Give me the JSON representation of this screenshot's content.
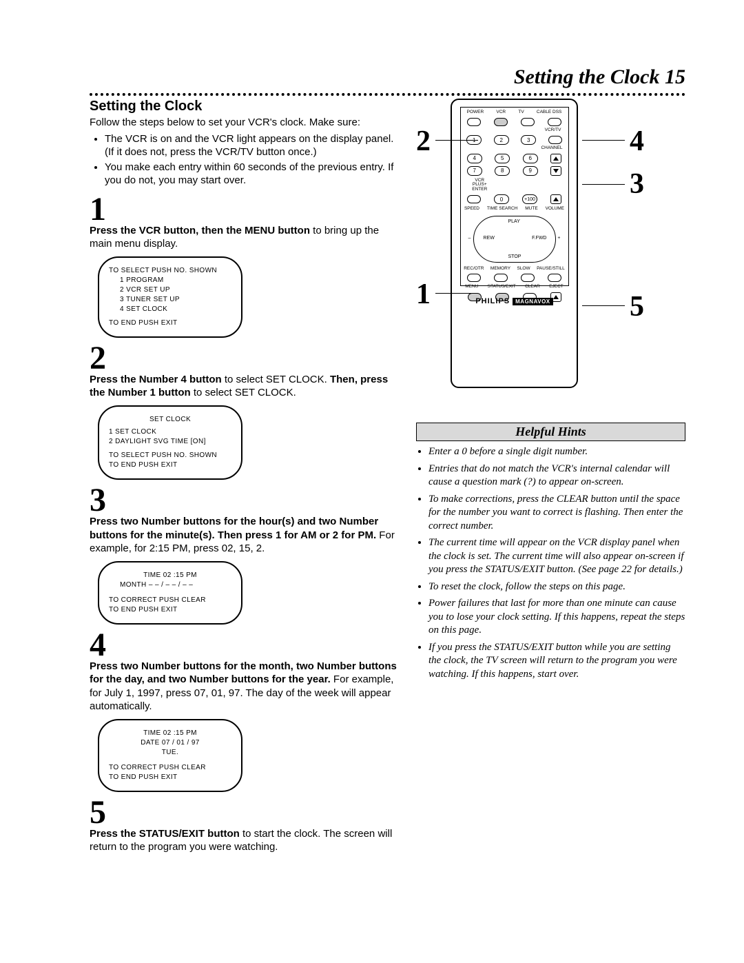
{
  "header": {
    "title": "Setting the Clock 15"
  },
  "section_title": "Setting the Clock",
  "intro": "Follow the steps below to set your VCR's clock. Make sure:",
  "bullets": [
    "The VCR is on and the VCR light appears on the display panel. (If it does not, press the VCR/TV button once.)",
    "You make each entry within 60 seconds of the previous entry. If you do not, you may start over."
  ],
  "steps": {
    "s1": {
      "num": "1",
      "bold": "Press the VCR button, then the MENU button",
      "rest": " to bring up the main menu display."
    },
    "s2": {
      "num": "2",
      "bold": "Press the Number 4 button",
      "mid": " to select SET CLOCK. ",
      "bold2": "Then, press the Number 1 button",
      "rest": " to select SET CLOCK."
    },
    "s3": {
      "num": "3",
      "bold": "Press two Number buttons for the hour(s) and two Number buttons for the minute(s). Then press 1 for AM or 2 for PM.",
      "rest": " For example, for 2:15 PM, press 02, 15, 2."
    },
    "s4": {
      "num": "4",
      "bold": "Press two Number buttons for the month, two Number buttons for the day, and two Number buttons for the year.",
      "rest": " For example, for July 1, 1997, press 07, 01, 97. The day of the week will appear automatically."
    },
    "s5": {
      "num": "5",
      "bold": "Press the STATUS/EXIT button",
      "rest": " to start the clock. The screen will return to the program you were watching."
    }
  },
  "osd": {
    "m1": {
      "l1": "TO SELECT PUSH NO. SHOWN",
      "l2": "1 PROGRAM",
      "l3": "2 VCR SET UP",
      "l4": "3 TUNER SET UP",
      "l5": "4 SET CLOCK",
      "l6": "TO END PUSH EXIT"
    },
    "m2": {
      "l1": "SET CLOCK",
      "l2": "1 SET CLOCK",
      "l3": "2 DAYLIGHT SVG TIME    [ON]",
      "l4": "TO SELECT PUSH NO. SHOWN",
      "l5": "TO END PUSH EXIT"
    },
    "m3": {
      "l1": "TIME  02 :15 PM",
      "l2": "MONTH – – / – – / – –",
      "l3": "TO CORRECT PUSH CLEAR",
      "l4": "TO END PUSH EXIT"
    },
    "m4": {
      "l1": "TIME  02 :15 PM",
      "l2": "DATE  07 / 01 / 97",
      "l3": "TUE.",
      "l4": "TO CORRECT PUSH CLEAR",
      "l5": "TO END PUSH EXIT"
    }
  },
  "remote": {
    "top_labels": {
      "power": "POWER",
      "vcr": "VCR",
      "tv": "TV",
      "cable": "CABLE DSS"
    },
    "vcrtv": "VCR/TV",
    "channel": "CHANNEL",
    "nums": {
      "n1": "1",
      "n2": "2",
      "n3": "3",
      "n4": "4",
      "n5": "5",
      "n6": "6",
      "n7": "7",
      "n8": "8",
      "n9": "9",
      "n0": "0",
      "n100": "+100"
    },
    "side": {
      "plus": "VCR PLUS+ ENTER",
      "speed": "SPEED",
      "ts": "TIME SEARCH",
      "mute": "MUTE",
      "vol": "VOLUME"
    },
    "dpad": {
      "play": "PLAY",
      "rew": "REW",
      "ff": "F.FWD",
      "stop": "STOP",
      "minus": "–",
      "plus": "+"
    },
    "row_a": {
      "rec": "REC/OTR",
      "mem": "MEMORY",
      "slow": "SLOW",
      "pause": "PAUSE/STILL"
    },
    "row_b": {
      "menu": "MENU",
      "status": "STATUS/EXIT",
      "clear": "CLEAR",
      "eject": "EJECT"
    },
    "brand": "PHILIPS",
    "brand2": "MAGNAVOX"
  },
  "callouts": {
    "c1": "1",
    "c2": "2",
    "c3": "3",
    "c4": "4",
    "c5": "5"
  },
  "hints": {
    "title": "Helpful Hints",
    "items": [
      "Enter a 0 before a single digit number.",
      "Entries that do not match the VCR's internal calendar will cause a question mark (?) to appear on-screen.",
      "To make corrections, press the CLEAR button until the space for the number you want to correct is flashing. Then enter the correct number.",
      "The current time will appear on the VCR display panel when the clock is set. The current time will also appear on-screen if you press the STATUS/EXIT button. (See page 22 for details.)",
      "To reset the clock, follow the steps on this page.",
      "Power failures that last for more than one minute can cause you to lose your clock setting. If this happens, repeat the steps on this page.",
      "If you press the STATUS/EXIT button while you are setting the clock, the TV screen will return to the program you were watching. If this happens, start over."
    ]
  }
}
